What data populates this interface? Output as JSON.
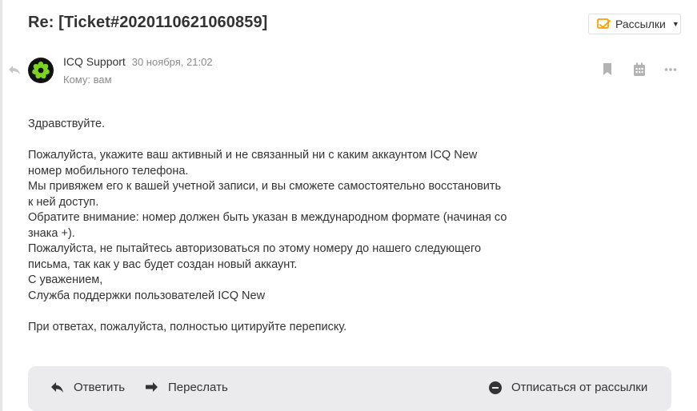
{
  "message": {
    "subject": "Re: [Ticket#2020110621060859]",
    "folder": "Рассылки",
    "sender_name": "ICQ Support",
    "date": "30 ноября, 21:02",
    "to_label": "Кому:",
    "to_value": "вам"
  },
  "body": [
    "Здравствуйте.",
    "",
    "Пожалуйста, укажите ваш активный и не связанный ни с каким аккаунтом ICQ New номер мобильного телефона.",
    "Мы привяжем его к вашей учетной записи, и вы сможете самостоятельно восстановить к ней доступ.",
    "Обратите внимание: номер должен быть указан в международном формате (начиная со знака +).",
    "Пожалуйста, не пытайтесь авторизоваться по этому номеру до нашего следующего письма, так как у вас будет создан новый аккаунт.",
    "С уважением,",
    "Служба поддержки пользователей ICQ New",
    "",
    "При ответах, пожалуйста, полностью цитируйте переписку."
  ],
  "actions": {
    "reply": "Ответить",
    "forward": "Переслать",
    "unsubscribe": "Отписаться от рассылки"
  },
  "icons": {
    "folder": "newsletter-folder-icon",
    "reply_indicator": "reply-arrow-icon",
    "bookmark": "bookmark-icon",
    "calendar": "calendar-icon",
    "more": "more-dots-icon",
    "avatar": "icq-flower-icon"
  },
  "colors": {
    "accent_orange": "#ff9e00",
    "icq_green": "#7dd321",
    "action_bar_bg": "#ebebee"
  }
}
